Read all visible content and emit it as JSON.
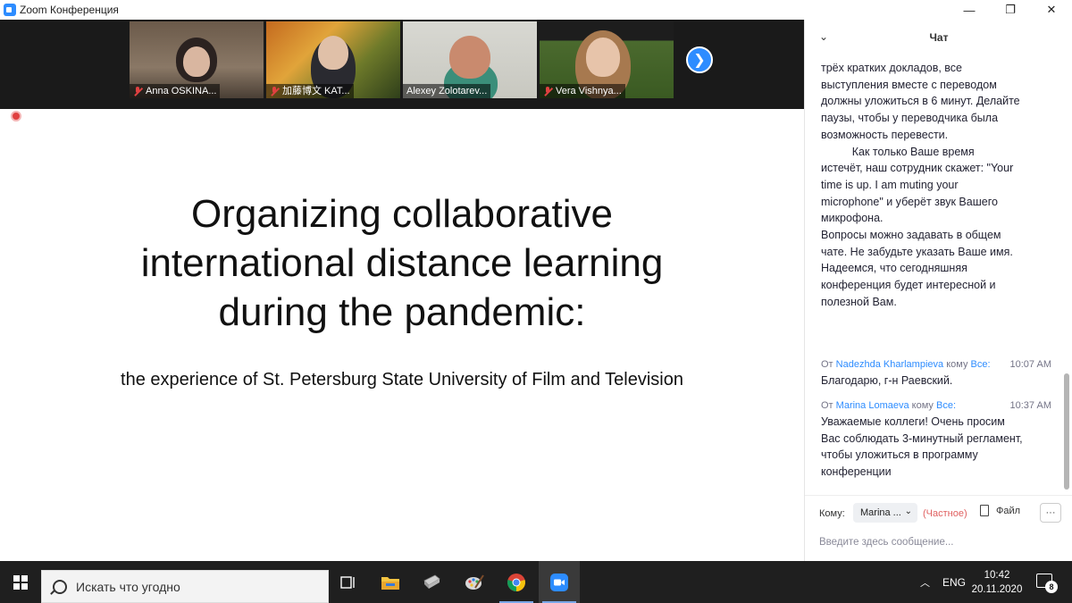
{
  "window": {
    "title": "Zoom Конференция",
    "minimize_glyph": "—",
    "restore_glyph": "❐",
    "close_glyph": "✕"
  },
  "participants": [
    {
      "name": "Anna OSKINA...",
      "muted": true
    },
    {
      "name": "加藤博文 KAT...",
      "muted": true
    },
    {
      "name": "Alexey Zolotarev...",
      "muted": false,
      "active_speaker": true
    },
    {
      "name": "Vera Vishnya...",
      "muted": true
    }
  ],
  "slide": {
    "title_lines": [
      "Organizing collaborative",
      "international distance learning",
      "during the pandemic:"
    ],
    "subtitle": "the experience of St. Petersburg State University of Film and Television"
  },
  "chat": {
    "header": "Чат",
    "first_message_text": "трёх кратких докладов, все\nвыступления вместе с переводом\nдолжны уложиться в 6 минут. Делайте\nпаузы, чтобы у переводчика была\nвозможность перевести.\n          Как только Ваше время\nистечёт, наш сотрудник скажет: \"Your\ntime is up. I am muting your\nmicrophone\" и уберёт звук Вашего\nмикрофона.\nВопросы можно задавать в общем\nчате. Не забудьте указать Ваше имя.\nНадеемся, что сегодняшняя\nконференция будет интересной и\nполезной Вам.",
    "messages": [
      {
        "from_prefix": "От",
        "sender": "Nadezhda Kharlampieva",
        "to_prefix": "кому",
        "recipient": "Все:",
        "time": "10:07 AM",
        "text": "Благодарю, г-н Раевский."
      },
      {
        "from_prefix": "От",
        "sender": "Marina Lomaeva",
        "to_prefix": "кому",
        "recipient": "Все:",
        "time": "10:37 AM",
        "text": "Уважаемые коллеги! Очень просим\nВас соблюдать 3-минутный регламент,\nчтобы уложиться в программу\nконференции"
      }
    ],
    "footer": {
      "to_label": "Кому:",
      "recipient_selected": "Marina ...",
      "private_label": "(Частное)",
      "file_label": "Файл",
      "more_label": "···",
      "input_placeholder": "Введите здесь сообщение..."
    }
  },
  "taskbar": {
    "search_placeholder": "Искать что угодно",
    "language": "ENG",
    "time": "10:42",
    "date": "20.11.2020",
    "notification_count": "8",
    "tray_chevron": "︿"
  }
}
